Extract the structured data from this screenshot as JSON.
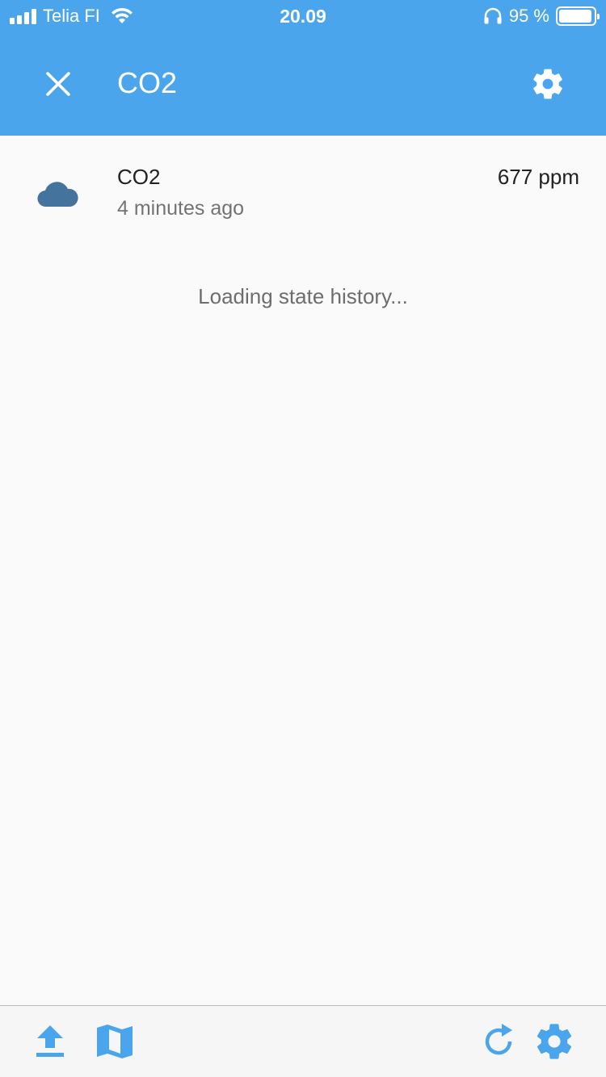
{
  "status_bar": {
    "carrier": "Telia FI",
    "time": "20.09",
    "battery_percent": "95 %",
    "battery_level": 0.95
  },
  "header": {
    "title": "CO2",
    "close_icon": "close-icon",
    "settings_icon": "gear-icon",
    "background": "#4ba5ec"
  },
  "entity": {
    "name": "CO2",
    "last_changed": "4 minutes ago",
    "state": "677 ppm",
    "icon": "cloud-icon",
    "icon_color": "#44739e"
  },
  "history": {
    "loading_text": "Loading state history..."
  },
  "toolbar": {
    "icons": [
      "upload-icon",
      "map-icon",
      "refresh-icon",
      "gear-icon"
    ],
    "accent": "#4ba5ec"
  }
}
